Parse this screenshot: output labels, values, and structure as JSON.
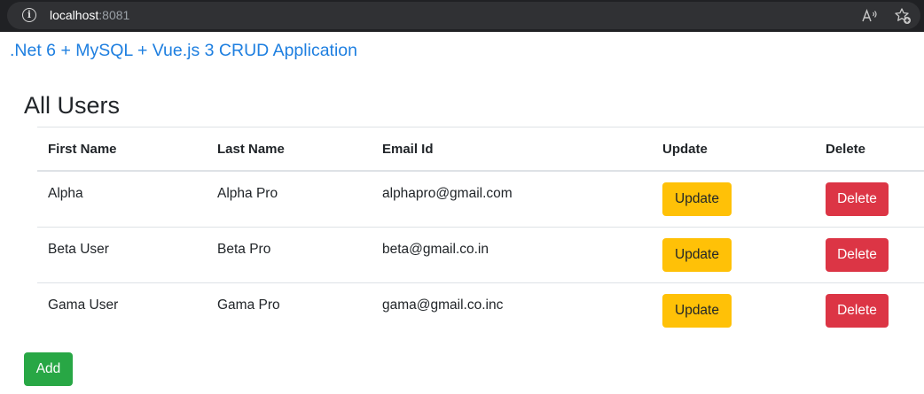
{
  "browser": {
    "url_host": "localhost",
    "url_port": ":8081",
    "icons": {
      "site_info": "info-icon",
      "read_aloud": "read-aloud-icon",
      "favorites": "add-favorite-icon"
    }
  },
  "app": {
    "title": ".Net 6 + MySQL + Vue.js 3 CRUD Application",
    "heading": "All Users",
    "colors": {
      "title": "#1e7fe0",
      "update": "#ffc107",
      "delete": "#dc3545",
      "add": "#28a745"
    }
  },
  "table": {
    "headers": {
      "first_name": "First Name",
      "last_name": "Last Name",
      "email": "Email Id",
      "update": "Update",
      "delete": "Delete"
    },
    "rows": [
      {
        "first_name": "Alpha",
        "last_name": "Alpha Pro",
        "email": "alphapro@gmail.com",
        "update_label": "Update",
        "delete_label": "Delete"
      },
      {
        "first_name": "Beta User",
        "last_name": "Beta Pro",
        "email": "beta@gmail.co.in",
        "update_label": "Update",
        "delete_label": "Delete"
      },
      {
        "first_name": "Gama User",
        "last_name": "Gama Pro",
        "email": "gama@gmail.co.inc",
        "update_label": "Update",
        "delete_label": "Delete"
      }
    ]
  },
  "actions": {
    "add_label": "Add"
  }
}
